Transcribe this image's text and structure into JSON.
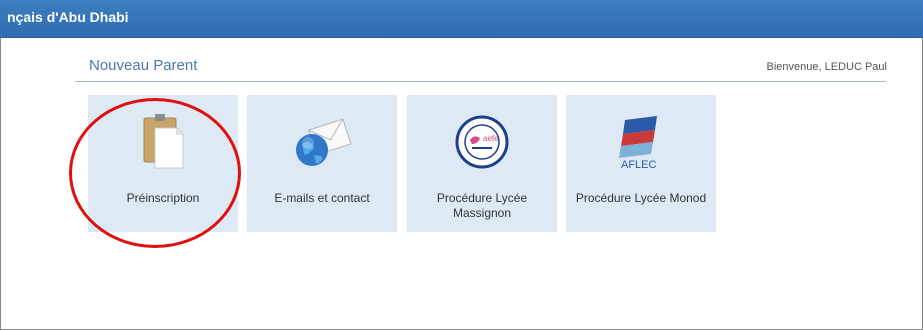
{
  "header": {
    "title": "nçais d'Abu Dhabi"
  },
  "page": {
    "title": "Nouveau Parent",
    "welcome": "Bienvenue, LEDUC Paul"
  },
  "tiles": [
    {
      "label": "Préinscription",
      "icon": "clipboard-icon"
    },
    {
      "label": "E-mails et contact",
      "icon": "email-globe-icon"
    },
    {
      "label": "Procédure Lycée Massignon",
      "icon": "lycee-massignon-logo"
    },
    {
      "label": "Procédure Lycée Monod",
      "icon": "aflec-logo"
    }
  ],
  "logos": {
    "massignon_badge": "aefe",
    "aflec_text": "AFLEC"
  },
  "colors": {
    "topbar": "#3a78bb",
    "title_text": "#4a77b4",
    "tile_bg": "#dde9f4",
    "highlight_circle": "#e01010"
  }
}
